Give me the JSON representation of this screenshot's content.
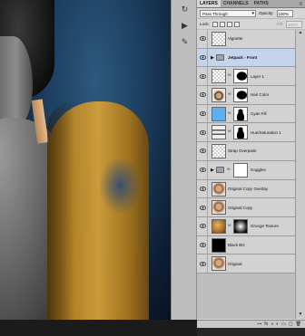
{
  "panel": {
    "tabs": [
      {
        "label": "LAYERS",
        "active": true
      },
      {
        "label": "CHANNELS",
        "active": false
      },
      {
        "label": "PATHS",
        "active": false
      }
    ],
    "menu_icon": "≡",
    "blend_mode": "Pass Through",
    "opacity_label": "Opacity:",
    "opacity_value": "100%",
    "lock_label": "Lock:",
    "fill_label": "Fill:",
    "fill_value": "100%"
  },
  "layers": [
    {
      "name": "Vignette",
      "thumb": "checker",
      "mask": false,
      "selected": false,
      "group": false
    },
    {
      "name": "Jetpack - Front",
      "thumb": "folder",
      "mask": false,
      "selected": true,
      "group": true
    },
    {
      "name": "Layer 1",
      "thumb": "checker",
      "mask": true,
      "mask_style": "dark-shape",
      "selected": false,
      "group": false
    },
    {
      "name": "Hair Color",
      "thumb": "hair",
      "mask": true,
      "mask_style": "dark-shape",
      "selected": false,
      "group": false
    },
    {
      "name": "Cyan Fill",
      "thumb": "cyan",
      "mask": true,
      "mask_style": "silhouette",
      "selected": false,
      "group": false
    },
    {
      "name": "Hue/Saturation 1",
      "thumb": "adjust",
      "mask": true,
      "mask_style": "silhouette",
      "selected": false,
      "group": false
    },
    {
      "name": "Strap Overpaint",
      "thumb": "checker",
      "mask": false,
      "selected": false,
      "group": false
    },
    {
      "name": "Goggles",
      "thumb": "folder",
      "mask": true,
      "mask_style": "white",
      "selected": false,
      "group": true
    },
    {
      "name": "Original Copy Overlay",
      "thumb": "portrait",
      "mask": false,
      "selected": false,
      "group": false
    },
    {
      "name": "Original Copy",
      "thumb": "portrait",
      "mask": false,
      "selected": false,
      "group": false
    },
    {
      "name": "Grunge Texture",
      "thumb": "grunge",
      "mask": true,
      "mask_style": "radial",
      "selected": false,
      "group": false
    },
    {
      "name": "Black BG",
      "thumb": "black",
      "mask": false,
      "selected": false,
      "group": false
    },
    {
      "name": "Original",
      "thumb": "portrait",
      "mask": false,
      "selected": false,
      "group": false
    }
  ],
  "icons": {
    "eye": "eye-icon",
    "link": "link-icon",
    "folder": "folder-icon",
    "triangle": "disclosure-triangle-icon"
  },
  "bottom_bar": [
    "⊶",
    "fx",
    "◑",
    "◐",
    "▭",
    "▢",
    "🗑"
  ],
  "colors": {
    "selection": "#c4d4ee",
    "cyan_fill": "#5ab0f0",
    "jetpack": "#c8942e"
  }
}
